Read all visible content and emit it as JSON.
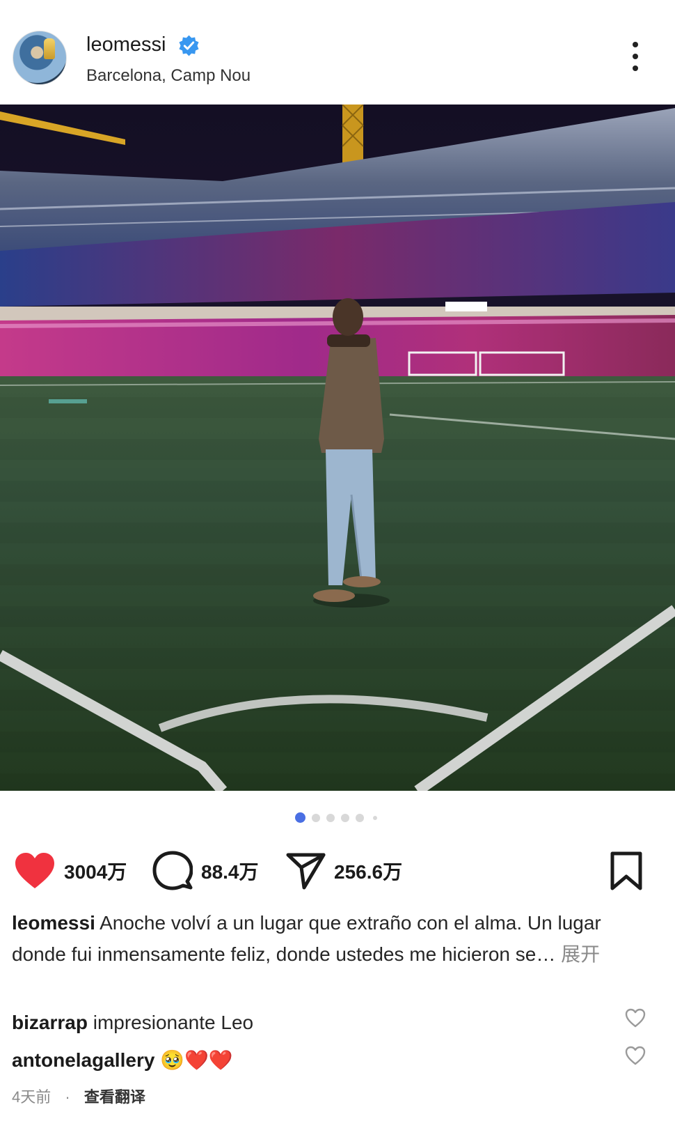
{
  "post": {
    "username": "leomessi",
    "location": "Barcelona, Camp Nou",
    "verified": true
  },
  "carousel": {
    "total": 6,
    "active": 1
  },
  "stats": {
    "likes": "3004万",
    "comments": "88.4万",
    "shares": "256.6万"
  },
  "caption": {
    "username": "leomessi",
    "text": "Anoche volví a un lugar que extraño con el alma. Un lugar donde fui inmensamente feliz, donde ustedes me hicieron se…",
    "more": "展开"
  },
  "comments": [
    {
      "user": "bizarrap",
      "text": "impresionante Leo"
    },
    {
      "user": "antonelagallery",
      "text": "🥹❤️❤️"
    }
  ],
  "meta": {
    "time": "4天前",
    "separator": "·",
    "translate": "查看翻译"
  },
  "colors": {
    "like_red": "#f0323f",
    "verified_blue": "#3897f0",
    "dot_active": "#4a6fe3",
    "dot_inactive": "#d8d8d8"
  },
  "icons": [
    "verified-badge-icon",
    "more-options-icon",
    "heart-icon",
    "comment-icon",
    "share-icon",
    "bookmark-icon"
  ]
}
